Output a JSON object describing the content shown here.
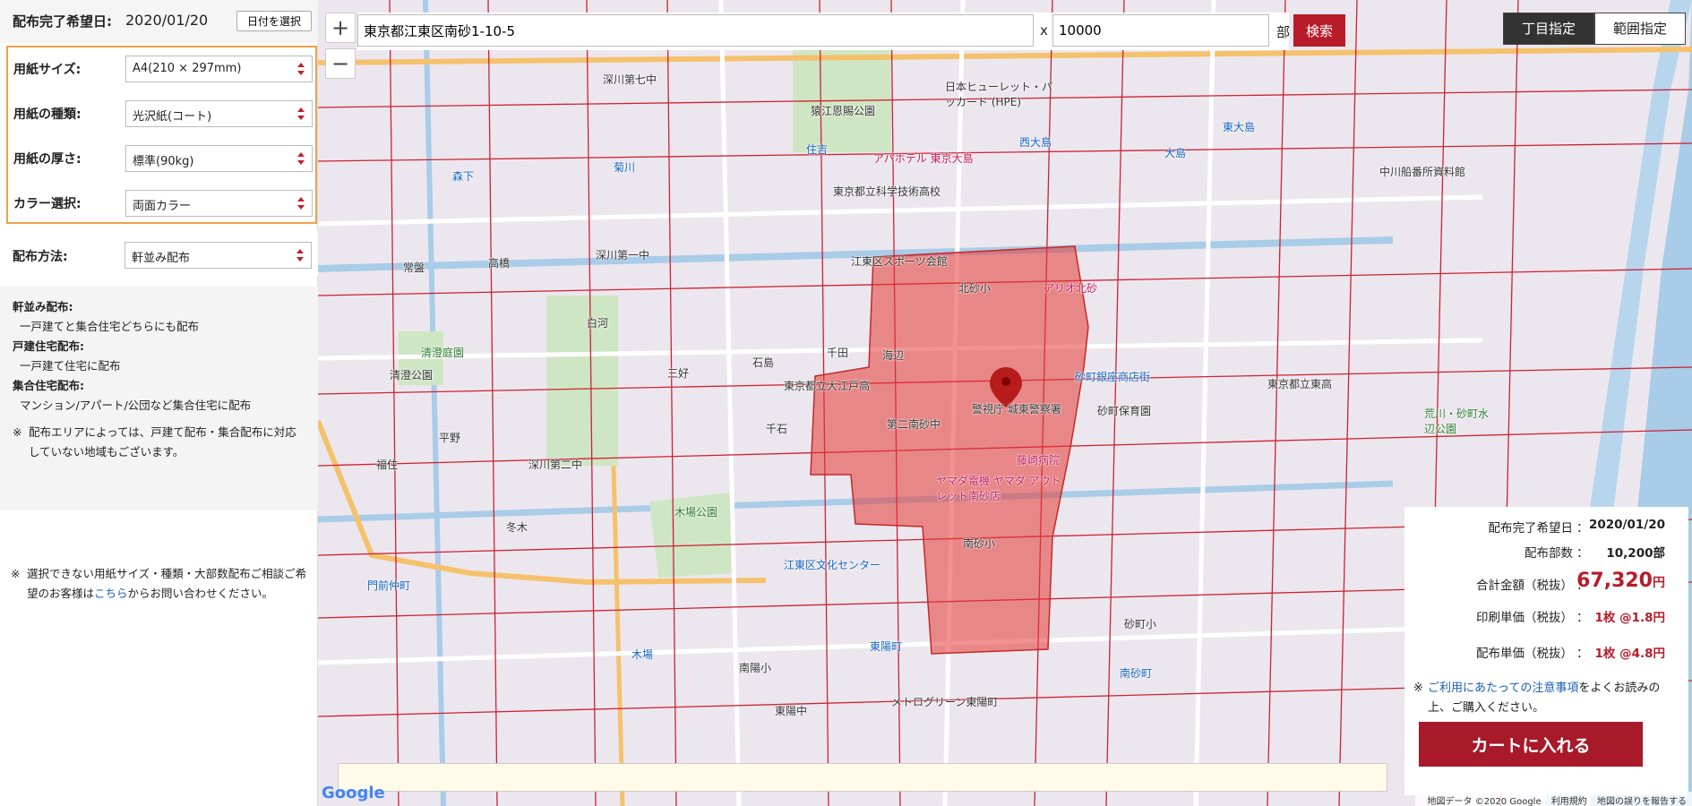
{
  "left": {
    "date_label": "配布完了希望日:",
    "date_value": "2020/01/20",
    "date_button": "日付を選択",
    "options": [
      {
        "label": "用紙サイズ:",
        "value": "A4(210 × 297mm)"
      },
      {
        "label": "用紙の種類:",
        "value": "光沢紙(コート)"
      },
      {
        "label": "用紙の厚さ:",
        "value": "標準(90kg)"
      },
      {
        "label": "カラー選択:",
        "value": "両面カラー"
      }
    ],
    "method": {
      "label": "配布方法:",
      "value": "軒並み配布"
    },
    "explain": [
      {
        "heading": "軒並み配布:",
        "desc": "一戸建てと集合住宅どちらにも配布"
      },
      {
        "heading": "戸建住宅配布:",
        "desc": "一戸建て住宅に配布"
      },
      {
        "heading": "集合住宅配布:",
        "desc": "マンション/アパート/公団など集合住宅に配布"
      }
    ],
    "explain_note_mark": "※",
    "explain_note": "配布エリアによっては、戸建て配布・集合配布に対応していない地域もございます。",
    "bottom_note_mark": "※",
    "bottom_note_pre": "選択できない用紙サイズ・種類・大部数配布ご相談ご希望のお客様は",
    "bottom_note_link": "こちら",
    "bottom_note_post": "からお問い合わせください。"
  },
  "map": {
    "zoom_in": "+",
    "zoom_out": "−",
    "address_value": "東京都江東区南砂1-10-5",
    "x_separator": "x",
    "quantity_value": "10000",
    "unit": "部",
    "search_button": "検索",
    "tabs": [
      "丁目指定",
      "範囲指定"
    ],
    "labels": [
      {
        "text": "猿江恩賜公園",
        "cls": "green"
      },
      {
        "text": "日本ヒューレット・パッカード (HPE)",
        "cls": ""
      },
      {
        "text": "アパホテル 東京大島",
        "cls": "pink"
      },
      {
        "text": "東京都立科学技術高校",
        "cls": ""
      },
      {
        "text": "江東区スポーツ会館",
        "cls": ""
      },
      {
        "text": "北砂小",
        "cls": ""
      },
      {
        "text": "アリオ北砂",
        "cls": "pink"
      },
      {
        "text": "砂町銀座商店街",
        "cls": "blue"
      },
      {
        "text": "警視庁 城東警察署",
        "cls": ""
      },
      {
        "text": "藤崎病院",
        "cls": "pink"
      },
      {
        "text": "ヤマダ電機 ヤマダ アウトレット南砂店",
        "cls": "pink"
      },
      {
        "text": "南砂小",
        "cls": ""
      },
      {
        "text": "木場公園",
        "cls": "green"
      },
      {
        "text": "江東区文化センター",
        "cls": "blue"
      },
      {
        "text": "深川第一中",
        "cls": ""
      },
      {
        "text": "清澄庭園",
        "cls": "green"
      },
      {
        "text": "清澄公園",
        "cls": ""
      },
      {
        "text": "常盤",
        "cls": ""
      },
      {
        "text": "高橋",
        "cls": ""
      },
      {
        "text": "白河",
        "cls": ""
      },
      {
        "text": "三好",
        "cls": ""
      },
      {
        "text": "千田",
        "cls": ""
      },
      {
        "text": "石島",
        "cls": ""
      },
      {
        "text": "海辺",
        "cls": ""
      },
      {
        "text": "千石",
        "cls": ""
      },
      {
        "text": "東陽町",
        "cls": "blue"
      },
      {
        "text": "南砂町",
        "cls": "blue"
      },
      {
        "text": "東大島",
        "cls": "blue"
      },
      {
        "text": "大島",
        "cls": "blue"
      },
      {
        "text": "西大島",
        "cls": "blue"
      },
      {
        "text": "住吉",
        "cls": "blue"
      },
      {
        "text": "菊川",
        "cls": "blue"
      },
      {
        "text": "森下",
        "cls": "blue"
      },
      {
        "text": "木場",
        "cls": "blue"
      },
      {
        "text": "門前仲町",
        "cls": "blue"
      },
      {
        "text": "荒川・砂町水辺公園",
        "cls": "green"
      },
      {
        "text": "中川船番所資料館",
        "cls": ""
      },
      {
        "text": "メトログリーン東陽町",
        "cls": ""
      },
      {
        "text": "深川第七中",
        "cls": ""
      },
      {
        "text": "深川第二中",
        "cls": ""
      },
      {
        "text": "冬木",
        "cls": ""
      },
      {
        "text": "福住",
        "cls": ""
      },
      {
        "text": "平野",
        "cls": ""
      },
      {
        "text": "第二南砂中",
        "cls": ""
      },
      {
        "text": "東京都立大江戸高",
        "cls": ""
      },
      {
        "text": "砂町保育園",
        "cls": ""
      },
      {
        "text": "東京都立東高",
        "cls": ""
      },
      {
        "text": "砂町小",
        "cls": ""
      },
      {
        "text": "南陽小",
        "cls": ""
      },
      {
        "text": "東陽中",
        "cls": ""
      }
    ],
    "info": {
      "rows": [
        {
          "label": "配布完了希望日",
          "value": "2020/01/20"
        },
        {
          "label": "配布部数",
          "value": "10,200部"
        },
        {
          "label": "合計金額（税抜）",
          "value": "67,320",
          "suffix": "円"
        },
        {
          "label": "印刷単価（税抜）",
          "value": "1枚 @1.8円"
        },
        {
          "label": "配布単価（税抜）",
          "value": "1枚 @4.8円"
        }
      ],
      "colon": "：",
      "note_mark": "※",
      "note_link": "ご利用にあたっての注意事項",
      "note_post": "をよくお読みの上、ご購入ください。",
      "cart_button": "カートに入れる"
    },
    "google_logo": "Google",
    "attribution": [
      "地図データ ©2020 Google",
      "利用規約",
      "地図の誤りを報告する"
    ]
  },
  "colors": {
    "accent": "#b71c2a",
    "highlight_border": "#f0a14b",
    "area_fill": "#e53935"
  }
}
